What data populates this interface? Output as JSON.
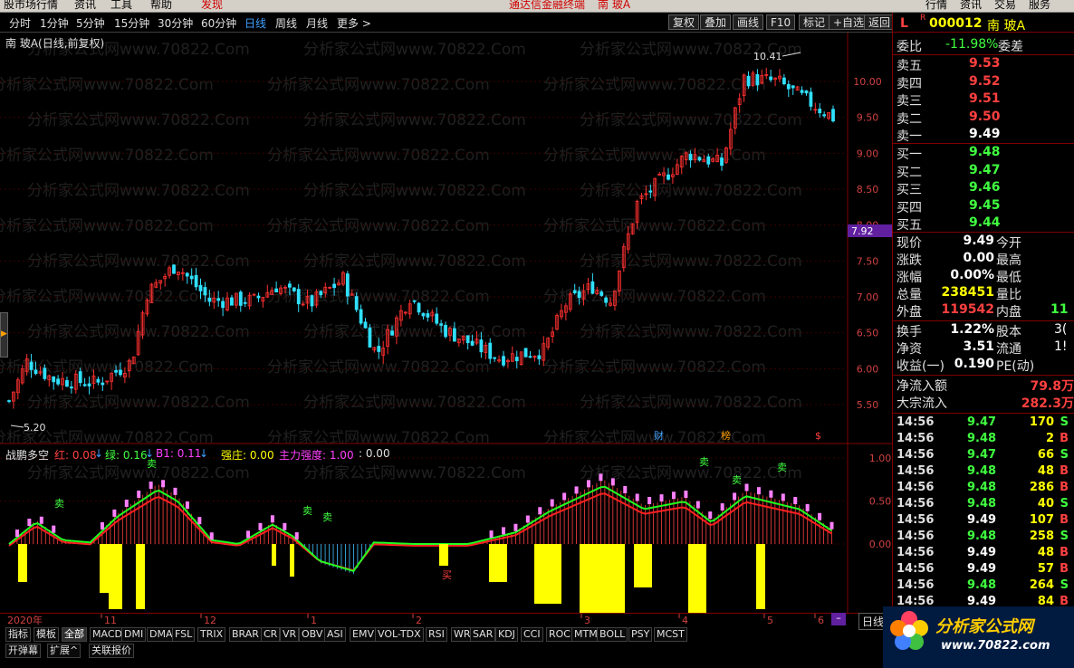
{
  "menubar": {
    "items": [
      "股市场行情",
      "资讯",
      "工具",
      "帮助"
    ],
    "discover": "发现",
    "title": "通达信金融终端",
    "stock": "南 玻A",
    "right_items": [
      "行情",
      "资讯",
      "交易",
      "服务"
    ]
  },
  "toolbar": {
    "periods": [
      "分时",
      "1分钟",
      "5分钟",
      "15分钟",
      "30分钟",
      "60分钟",
      "日线",
      "周线",
      "月线",
      "更多 >"
    ],
    "active_period": "日线",
    "buttons": [
      "复权",
      "叠加",
      "画线",
      "F10",
      "标记",
      "+自选",
      "返回"
    ]
  },
  "chart": {
    "header": "南 玻A(日线,前复权)",
    "high_label": "10.41",
    "low_label": "5.20",
    "price_ticks": [
      "10.00",
      "9.50",
      "9.00",
      "8.50",
      "8.00",
      "7.50",
      "7.00",
      "6.50",
      "6.00",
      "5.50"
    ],
    "current_price_tag": "7.92",
    "markers": [
      "财",
      "榜",
      "$"
    ],
    "watermark": "分析家公式网www.70822.Com"
  },
  "indicator": {
    "name": "战鹏多空",
    "red": "红: 0.08",
    "green": "绿: 0.16",
    "b1": "B1: 0.11",
    "strong": "强庄: 0.00",
    "main_strength": "主力强度: 1.00",
    "extra": ": 0.00",
    "ticks": [
      "1.00",
      "0.50",
      "0.00"
    ],
    "signals": [
      "卖",
      "卖",
      "卖",
      "卖",
      "卖",
      "卖",
      "买",
      "卖"
    ]
  },
  "date_axis": {
    "labels": [
      "2020年",
      "11",
      "12",
      "1",
      "2",
      "3",
      "4",
      "5",
      "6"
    ]
  },
  "bottom": {
    "row1_tabs": [
      "指标",
      "模板",
      "全部",
      "MACD",
      "DMI",
      "DMA",
      "FSL",
      "TRIX",
      "BRAR",
      "CR",
      "VR",
      "OBV",
      "ASI",
      "EMV",
      "VOL-TDX",
      "RSI",
      "WR",
      "SAR",
      "KDJ",
      "CCI",
      "ROC",
      "MTM",
      "BOLL",
      "PSY",
      "MCST"
    ],
    "row2_tabs": [
      "开弹幕",
      "扩展^",
      "关联报价"
    ],
    "period_label": "日线"
  },
  "quote": {
    "flag": "L",
    "code": "000012",
    "name": "南 玻A",
    "ratio_label": "委比",
    "ratio_value": "-11.98%",
    "diff_label": "委差",
    "asks": [
      {
        "label": "卖五",
        "price": "9.53"
      },
      {
        "label": "卖四",
        "price": "9.52"
      },
      {
        "label": "卖三",
        "price": "9.51"
      },
      {
        "label": "卖二",
        "price": "9.50"
      },
      {
        "label": "卖一",
        "price": "9.49"
      }
    ],
    "bids": [
      {
        "label": "买一",
        "price": "9.48"
      },
      {
        "label": "买二",
        "price": "9.47"
      },
      {
        "label": "买三",
        "price": "9.46"
      },
      {
        "label": "买四",
        "price": "9.45"
      },
      {
        "label": "买五",
        "price": "9.44"
      }
    ],
    "stats": [
      {
        "l1": "现价",
        "v1": "9.49",
        "l2": "今开",
        "c": "#ffffff"
      },
      {
        "l1": "涨跌",
        "v1": "0.00",
        "l2": "最高",
        "c": "#ffffff"
      },
      {
        "l1": "涨幅",
        "v1": "0.00%",
        "l2": "最低",
        "c": "#ffffff"
      },
      {
        "l1": "总量",
        "v1": "238451",
        "l2": "量比",
        "c": "#ffff00"
      },
      {
        "l1": "外盘",
        "v1": "119542",
        "l2": "内盘",
        "c": "#ff4040",
        "v2": "11",
        "c2": "#40ff40"
      }
    ],
    "stats2": [
      {
        "l1": "换手",
        "v1": "1.22%",
        "l2": "股本",
        "v2": "3("
      },
      {
        "l1": "净资",
        "v1": "3.51",
        "l2": "流通",
        "v2": "1!"
      },
      {
        "l1": "收益(一)",
        "v1": "0.190",
        "l2": "PE(动)",
        "v2": ""
      }
    ],
    "flow": [
      {
        "label": "净流入额",
        "value": "79.8万"
      },
      {
        "label": "大宗流入",
        "value": "282.3万"
      }
    ],
    "ticks": [
      {
        "time": "14:56",
        "price": "9.47",
        "vol": "170",
        "side": "S"
      },
      {
        "time": "14:56",
        "price": "9.48",
        "vol": "2",
        "side": "B"
      },
      {
        "time": "14:56",
        "price": "9.47",
        "vol": "66",
        "side": "S"
      },
      {
        "time": "14:56",
        "price": "9.48",
        "vol": "48",
        "side": "B"
      },
      {
        "time": "14:56",
        "price": "9.48",
        "vol": "286",
        "side": "B"
      },
      {
        "time": "14:56",
        "price": "9.48",
        "vol": "40",
        "side": "S"
      },
      {
        "time": "14:56",
        "price": "9.49",
        "vol": "107",
        "side": "B"
      },
      {
        "time": "14:56",
        "price": "9.48",
        "vol": "258",
        "side": "S"
      },
      {
        "time": "14:56",
        "price": "9.49",
        "vol": "48",
        "side": "B"
      },
      {
        "time": "14:56",
        "price": "9.49",
        "vol": "57",
        "side": "B"
      },
      {
        "time": "14:56",
        "price": "9.48",
        "vol": "264",
        "side": "S"
      },
      {
        "time": "14:56",
        "price": "9.49",
        "vol": "84",
        "side": "B"
      }
    ],
    "logo_text": "分析家公式网",
    "logo_url": "www.70822.com"
  }
}
